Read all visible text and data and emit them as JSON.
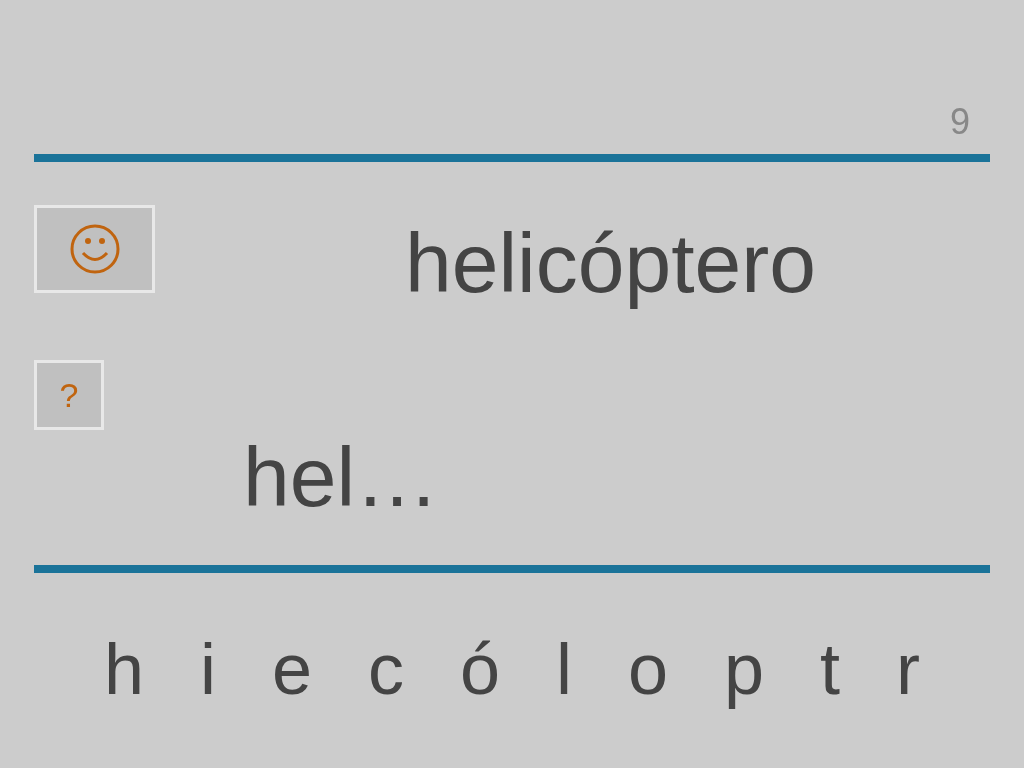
{
  "page_number": "9",
  "word": "helicóptero",
  "hint_button": {
    "label": "?"
  },
  "answer": "hel…",
  "letters": [
    "h",
    "i",
    "e",
    "c",
    "ó",
    "l",
    "o",
    "p",
    "t",
    "r"
  ]
}
